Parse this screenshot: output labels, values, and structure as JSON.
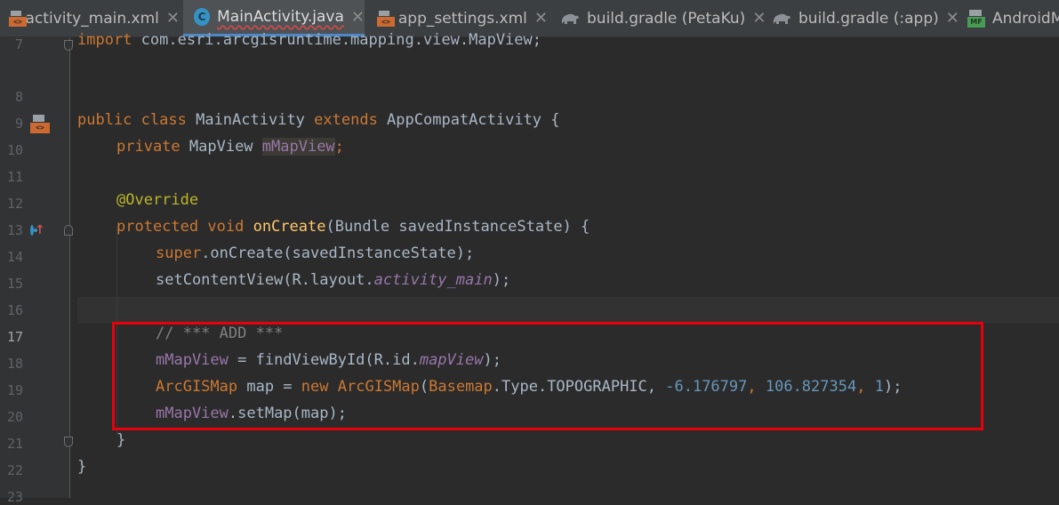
{
  "tabs": [
    {
      "label": "activity_main.xml",
      "icon": "xml-file-icon",
      "active": false
    },
    {
      "label": "MainActivity.java",
      "icon": "java-class-icon",
      "active": true
    },
    {
      "label": "app_settings.xml",
      "icon": "xml-file-icon",
      "active": false
    },
    {
      "label": "build.gradle (PetaKu)",
      "icon": "gradle-elephant-icon",
      "active": false
    },
    {
      "label": "build.gradle (:app)",
      "icon": "gradle-elephant-icon",
      "active": false
    },
    {
      "label": "AndroidM",
      "icon": "manifest-icon",
      "active": false
    }
  ],
  "close_glyph": "✕",
  "gutter": {
    "line_numbers": [
      "7",
      "8",
      "9",
      "10",
      "11",
      "12",
      "13",
      "14",
      "15",
      "16",
      "17",
      "18",
      "19",
      "20",
      "21",
      "22",
      "23"
    ],
    "current_line": "17",
    "icons": {
      "line_10": "xml-layout-icon",
      "line_14": "override-method-icon"
    }
  },
  "code": {
    "l7": [
      "import",
      " com.esri.arcgisruntime.mapping.view.MapView;"
    ],
    "l10": [
      "public",
      " ",
      "class",
      " MainActivity ",
      "extends",
      " AppCompatActivity {"
    ],
    "l11": [
      "private",
      " MapView ",
      "mMapView",
      ";"
    ],
    "l13": [
      "@Override"
    ],
    "l14": [
      "protected",
      " ",
      "void",
      " ",
      "onCreate",
      "(Bundle savedInstanceState) {"
    ],
    "l15": [
      "super",
      ".onCreate(savedInstanceState);"
    ],
    "l16": [
      "setContentView(R.layout.",
      "activity_main",
      ");"
    ],
    "l18": [
      "// *** ADD ***"
    ],
    "l19": [
      "mMapView",
      " = findViewById(R.id.",
      "mapView",
      ");"
    ],
    "l20": [
      "ArcGISMap",
      " map = ",
      "new",
      " ",
      "ArcGISMap",
      "(",
      "Basemap",
      ".Type.TOPOGRAPHIC, ",
      "-6.176797",
      ", ",
      "106.827354",
      ", ",
      "1",
      ");"
    ],
    "l21": [
      "mMapView",
      ".setMap(map);"
    ],
    "l22": [
      "}"
    ],
    "l23": [
      "}"
    ]
  },
  "colors": {
    "background": "#2b2b2b",
    "keyword": "#cc7832",
    "annotation": "#bbb529",
    "field": "#9876aa",
    "method": "#ffc66d",
    "number": "#6897bb",
    "comment": "#808080",
    "highlight_box": "#e8000b"
  }
}
